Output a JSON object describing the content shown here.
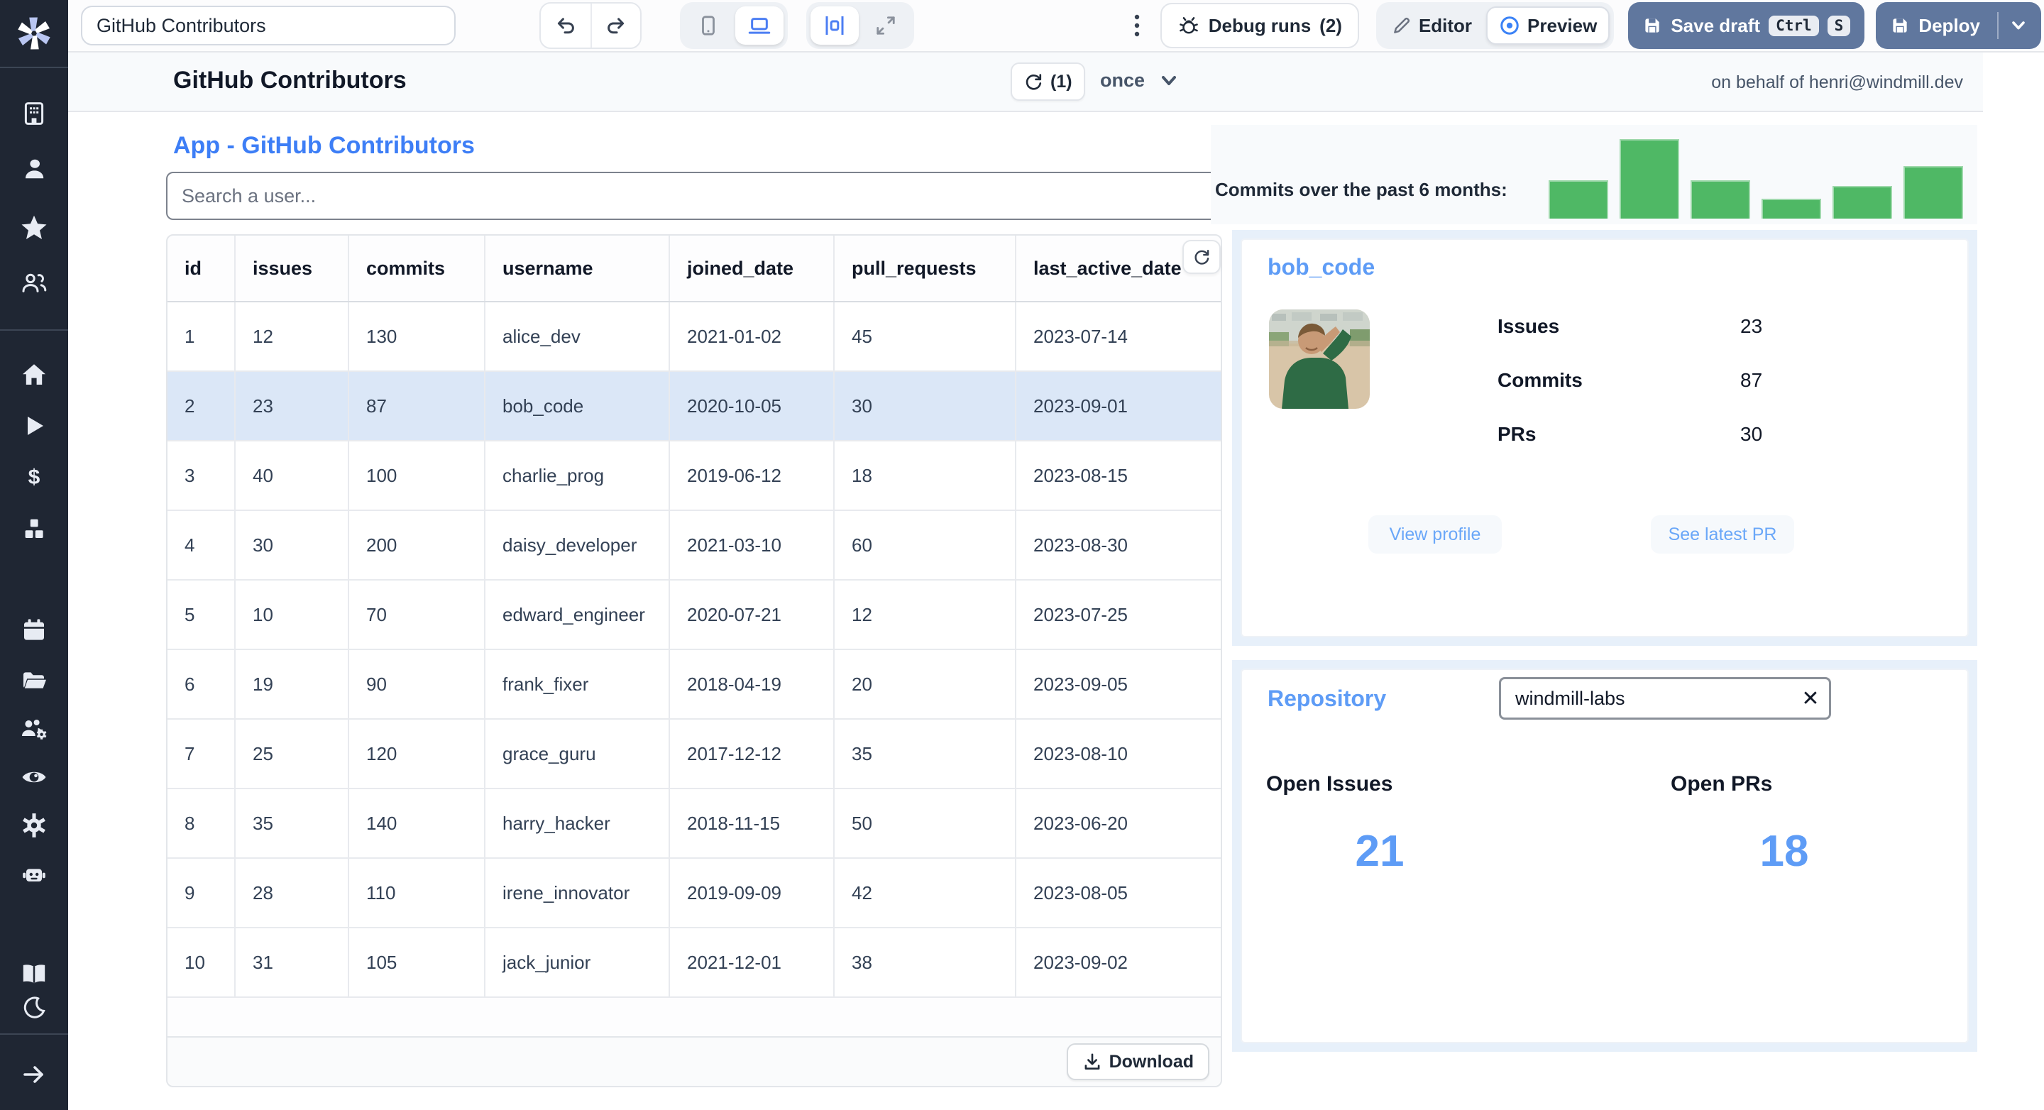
{
  "topbar": {
    "app_name_input": "GitHub Contributors",
    "debug_runs_label": "Debug runs",
    "debug_runs_count": "(2)",
    "editor_label": "Editor",
    "preview_label": "Preview",
    "save_draft_label": "Save draft",
    "kbd_ctrl": "Ctrl",
    "kbd_s": "S",
    "deploy_label": "Deploy"
  },
  "sidebar": {
    "icons": [
      "building-icon",
      "user-icon",
      "star-icon",
      "users-icon",
      "home-icon",
      "play-icon",
      "dollar-icon",
      "cubes-icon",
      "calendar-icon",
      "folder-icon",
      "users-gear-icon",
      "eye-icon",
      "gear-icon",
      "robot-icon",
      "book-icon",
      "moon-icon",
      "arrow-right-icon"
    ]
  },
  "header": {
    "title": "GitHub Contributors",
    "refresh_count": "(1)",
    "schedule_label": "once",
    "on_behalf": "on behalf of henri@windmill.dev"
  },
  "main": {
    "app_title": "App - GitHub Contributors",
    "search_placeholder": "Search a user...",
    "table": {
      "columns": [
        "id",
        "issues",
        "commits",
        "username",
        "joined_date",
        "pull_requests",
        "last_active_date"
      ],
      "rows": [
        [
          "1",
          "12",
          "130",
          "alice_dev",
          "2021-01-02",
          "45",
          "2023-07-14"
        ],
        [
          "2",
          "23",
          "87",
          "bob_code",
          "2020-10-05",
          "30",
          "2023-09-01"
        ],
        [
          "3",
          "40",
          "100",
          "charlie_prog",
          "2019-06-12",
          "18",
          "2023-08-15"
        ],
        [
          "4",
          "30",
          "200",
          "daisy_developer",
          "2021-03-10",
          "60",
          "2023-08-30"
        ],
        [
          "5",
          "10",
          "70",
          "edward_engineer",
          "2020-07-21",
          "12",
          "2023-07-25"
        ],
        [
          "6",
          "19",
          "90",
          "frank_fixer",
          "2018-04-19",
          "20",
          "2023-09-05"
        ],
        [
          "7",
          "25",
          "120",
          "grace_guru",
          "2017-12-12",
          "35",
          "2023-08-10"
        ],
        [
          "8",
          "35",
          "140",
          "harry_hacker",
          "2018-11-15",
          "50",
          "2023-06-20"
        ],
        [
          "9",
          "28",
          "110",
          "irene_innovator",
          "2019-09-09",
          "42",
          "2023-08-05"
        ],
        [
          "10",
          "31",
          "105",
          "jack_junior",
          "2021-12-01",
          "38",
          "2023-09-02"
        ]
      ],
      "selected_row_index": 1,
      "download_label": "Download"
    }
  },
  "chart_data": {
    "type": "bar",
    "title": "Commits over the past 6 months:",
    "series": [
      {
        "name": "commits",
        "values_relative_pct": [
          49,
          100,
          49,
          25,
          41,
          66
        ]
      }
    ],
    "bar_color": "#4fb865",
    "axes_visible": false,
    "legend": "none"
  },
  "user_card": {
    "username": "bob_code",
    "stats": [
      {
        "label": "Issues",
        "value": "23"
      },
      {
        "label": "Commits",
        "value": "87"
      },
      {
        "label": "PRs",
        "value": "30"
      }
    ],
    "buttons": [
      "View profile",
      "See latest PR"
    ]
  },
  "repo_card": {
    "title": "Repository",
    "input_value": "windmill-labs",
    "open_issues_label": "Open Issues",
    "open_issues_value": "21",
    "open_prs_label": "Open PRs",
    "open_prs_value": "18"
  },
  "colors": {
    "sidebar_bg": "#1f2633",
    "accent_blue": "#3d7ef6",
    "light_blue_text": "#5e9cf6",
    "deploy_button": "#60779e",
    "bar_green": "#4fb865",
    "selected_row": "#dbe7f7",
    "panel_blue": "#e7f0fa"
  }
}
